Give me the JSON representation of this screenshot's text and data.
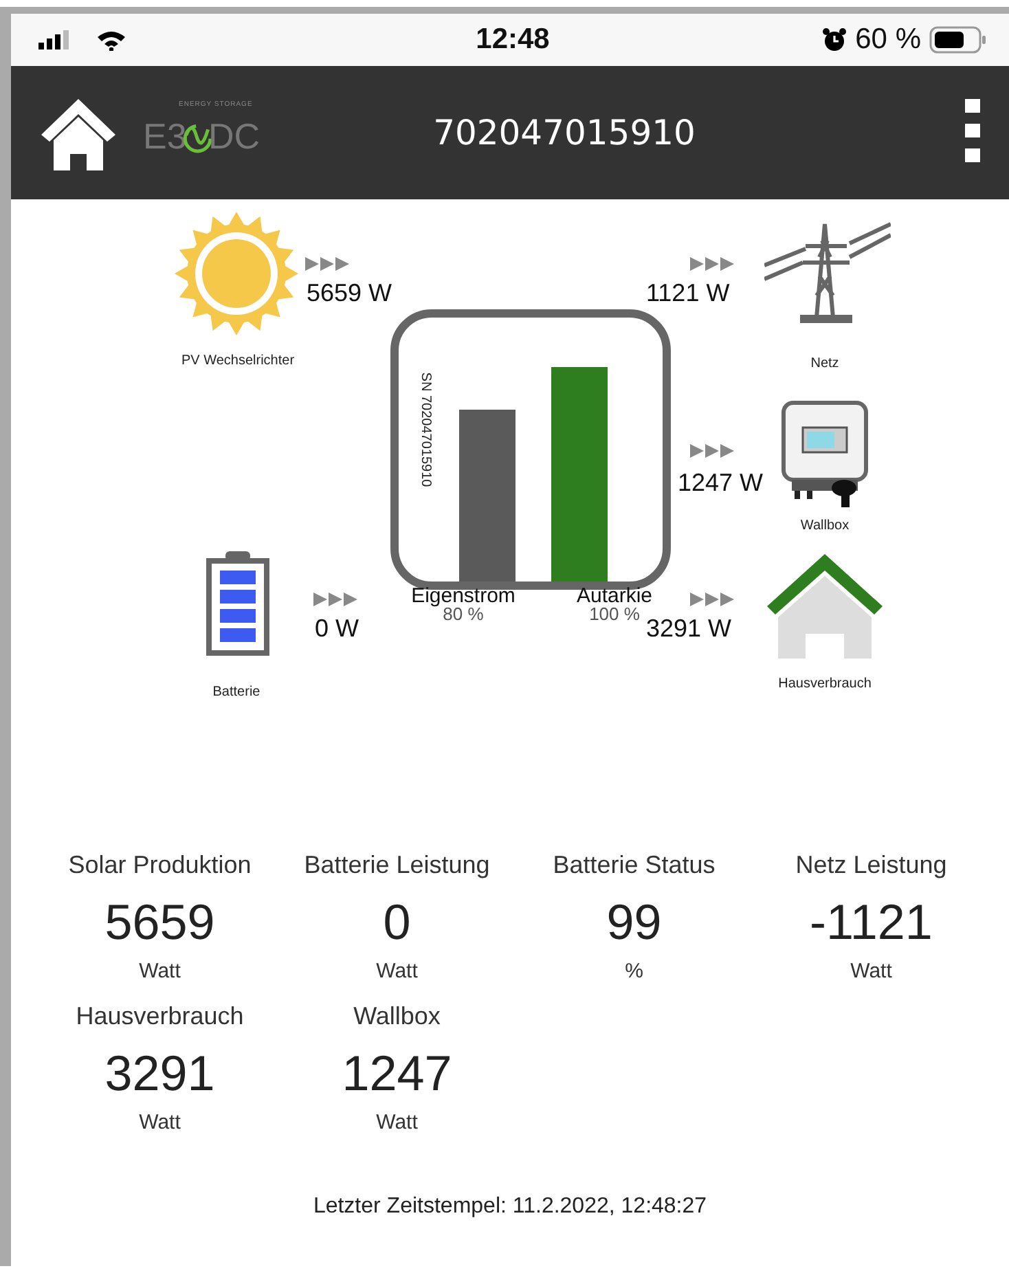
{
  "status_bar": {
    "time": "12:48",
    "battery": "60 %"
  },
  "header": {
    "logo": {
      "tagline": "ENERGY STORAGE",
      "left": "E3",
      "right": "DC"
    },
    "title": "702047015910"
  },
  "flow": {
    "serial": "SN 702047015910",
    "nodes": [
      {
        "kind": "sun",
        "label": "PV Wechselrichter",
        "reading": "5659 W"
      },
      {
        "kind": "grid",
        "label": "Netz",
        "reading": "1121 W"
      },
      {
        "kind": "wallbox",
        "label": "Wallbox",
        "reading": "1247 W"
      },
      {
        "kind": "battery",
        "label": "Batterie",
        "reading": "0 W"
      },
      {
        "kind": "house",
        "label": "Hausverbrauch",
        "reading": "3291 W"
      }
    ],
    "bars": [
      {
        "label": "Eigenstrom",
        "reading": "80 %",
        "color": "#5a5a5a"
      },
      {
        "label": "Autarkie",
        "reading": "100 %",
        "color": "#2e7d1f"
      }
    ]
  },
  "stats": [
    {
      "label": "Solar Produktion",
      "value": "5659",
      "unit": "Watt"
    },
    {
      "label": "Batterie Leistung",
      "value": "0",
      "unit": "Watt"
    },
    {
      "label": "Batterie Status",
      "value": "99",
      "unit": "%"
    },
    {
      "label": "Netz Leistung",
      "value": "-1121",
      "unit": "Watt"
    },
    {
      "label": "Hausverbrauch",
      "value": "3291",
      "unit": "Watt"
    },
    {
      "label": "Wallbox",
      "value": "1247",
      "unit": "Watt"
    }
  ],
  "footer": "Letzter Zeitstempel: 11.2.2022, 12:48:27"
}
